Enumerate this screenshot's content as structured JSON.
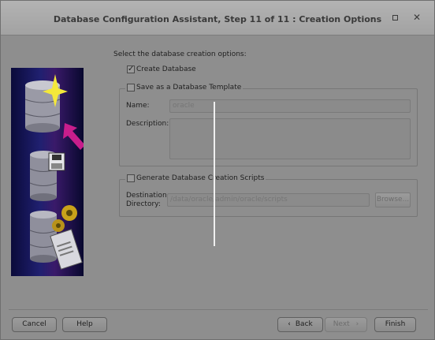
{
  "window": {
    "title": "Database Configuration Assistant, Step 11 of 11 : Creation Options"
  },
  "main": {
    "prompt": "Select the database creation options:",
    "create_db": {
      "label": "Create Database",
      "checked": true
    },
    "template": {
      "label": "Save as a Database Template",
      "checked": false,
      "name_label": "Name:",
      "name_value": "oracle",
      "description_label": "Description:",
      "description_value": ""
    },
    "scripts": {
      "label": "Generate Database Creation Scripts",
      "checked": false,
      "dest_label_line1": "Destination",
      "dest_label_line2": "Directory:",
      "dest_value": "/data/oracle/admin/oracle/scripts",
      "browse_label": "Browse..."
    }
  },
  "footer": {
    "cancel": "Cancel",
    "help": "Help",
    "back": "Back",
    "next": "Next",
    "finish": "Finish"
  },
  "icons": [
    "minimize-icon",
    "maximize-icon",
    "close-icon",
    "database-icon",
    "arrow-icon",
    "floppy-icon",
    "gear-icon",
    "sql-document-icon"
  ]
}
